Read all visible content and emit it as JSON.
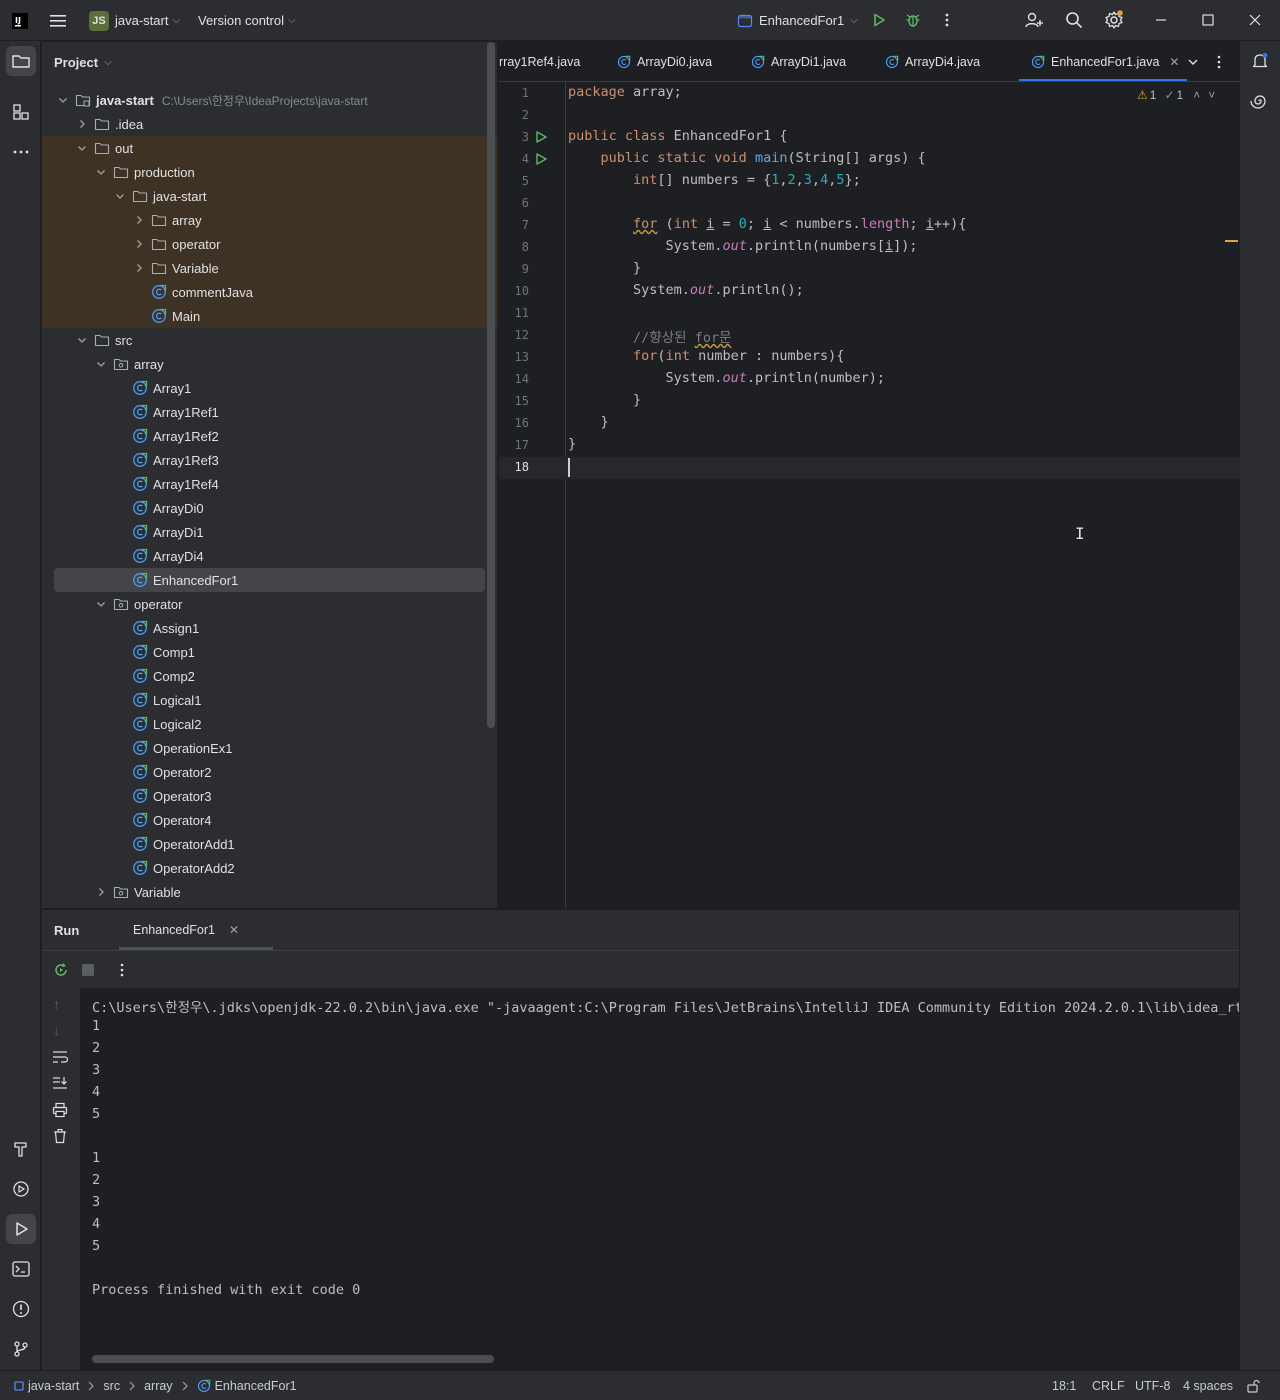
{
  "titlebar": {
    "project_badge": "JS",
    "project_name": "java-start",
    "vcs_label": "Version control",
    "run_config": "EnhancedFor1"
  },
  "project_panel": {
    "title": "Project",
    "tree": [
      {
        "label": "java-start",
        "path": "C:\\Users\\한정우\\IdeaProjects\\java-start",
        "indent": 0,
        "chevron": "down",
        "icon": "module",
        "bg": "none",
        "bold": true
      },
      {
        "label": ".idea",
        "indent": 1,
        "chevron": "right",
        "icon": "folder",
        "bg": "none"
      },
      {
        "label": "out",
        "indent": 1,
        "chevron": "down",
        "icon": "folder",
        "bg": "out"
      },
      {
        "label": "production",
        "indent": 2,
        "chevron": "down",
        "icon": "folder",
        "bg": "out"
      },
      {
        "label": "java-start",
        "indent": 3,
        "chevron": "down",
        "icon": "folder",
        "bg": "out"
      },
      {
        "label": "array",
        "indent": 4,
        "chevron": "right",
        "icon": "folder",
        "bg": "out"
      },
      {
        "label": "operator",
        "indent": 4,
        "chevron": "right",
        "icon": "folder",
        "bg": "out"
      },
      {
        "label": "Variable",
        "indent": 4,
        "chevron": "right",
        "icon": "folder",
        "bg": "out"
      },
      {
        "label": "commentJava",
        "indent": 4,
        "chevron": "none",
        "icon": "class",
        "bg": "out"
      },
      {
        "label": "Main",
        "indent": 4,
        "chevron": "none",
        "icon": "class",
        "bg": "out"
      },
      {
        "label": "src",
        "indent": 1,
        "chevron": "down",
        "icon": "folder",
        "bg": "none"
      },
      {
        "label": "array",
        "indent": 2,
        "chevron": "down",
        "icon": "package",
        "bg": "none"
      },
      {
        "label": "Array1",
        "indent": 3,
        "chevron": "none",
        "icon": "class",
        "bg": "none"
      },
      {
        "label": "Array1Ref1",
        "indent": 3,
        "chevron": "none",
        "icon": "class",
        "bg": "none"
      },
      {
        "label": "Array1Ref2",
        "indent": 3,
        "chevron": "none",
        "icon": "class",
        "bg": "none"
      },
      {
        "label": "Array1Ref3",
        "indent": 3,
        "chevron": "none",
        "icon": "class",
        "bg": "none"
      },
      {
        "label": "Array1Ref4",
        "indent": 3,
        "chevron": "none",
        "icon": "class",
        "bg": "none"
      },
      {
        "label": "ArrayDi0",
        "indent": 3,
        "chevron": "none",
        "icon": "class",
        "bg": "none"
      },
      {
        "label": "ArrayDi1",
        "indent": 3,
        "chevron": "none",
        "icon": "class",
        "bg": "none"
      },
      {
        "label": "ArrayDi4",
        "indent": 3,
        "chevron": "none",
        "icon": "class",
        "bg": "none"
      },
      {
        "label": "EnhancedFor1",
        "indent": 3,
        "chevron": "none",
        "icon": "class",
        "bg": "selected"
      },
      {
        "label": "operator",
        "indent": 2,
        "chevron": "down",
        "icon": "package",
        "bg": "none"
      },
      {
        "label": "Assign1",
        "indent": 3,
        "chevron": "none",
        "icon": "class",
        "bg": "none"
      },
      {
        "label": "Comp1",
        "indent": 3,
        "chevron": "none",
        "icon": "class",
        "bg": "none"
      },
      {
        "label": "Comp2",
        "indent": 3,
        "chevron": "none",
        "icon": "class",
        "bg": "none"
      },
      {
        "label": "Logical1",
        "indent": 3,
        "chevron": "none",
        "icon": "class",
        "bg": "none"
      },
      {
        "label": "Logical2",
        "indent": 3,
        "chevron": "none",
        "icon": "class",
        "bg": "none"
      },
      {
        "label": "OperationEx1",
        "indent": 3,
        "chevron": "none",
        "icon": "class",
        "bg": "none"
      },
      {
        "label": "Operator2",
        "indent": 3,
        "chevron": "none",
        "icon": "class",
        "bg": "none"
      },
      {
        "label": "Operator3",
        "indent": 3,
        "chevron": "none",
        "icon": "class",
        "bg": "none"
      },
      {
        "label": "Operator4",
        "indent": 3,
        "chevron": "none",
        "icon": "class",
        "bg": "none"
      },
      {
        "label": "OperatorAdd1",
        "indent": 3,
        "chevron": "none",
        "icon": "class",
        "bg": "none"
      },
      {
        "label": "OperatorAdd2",
        "indent": 3,
        "chevron": "none",
        "icon": "class",
        "bg": "none"
      },
      {
        "label": "Variable",
        "indent": 2,
        "chevron": "right",
        "icon": "package",
        "bg": "none"
      }
    ]
  },
  "editor": {
    "tabs": [
      {
        "label": "rray1Ref4.java",
        "active": false
      },
      {
        "label": "ArrayDi0.java",
        "active": false
      },
      {
        "label": "ArrayDi1.java",
        "active": false
      },
      {
        "label": "ArrayDi4.java",
        "active": false
      },
      {
        "label": "EnhancedFor1.java",
        "active": true
      }
    ],
    "warnings_count": "1",
    "checks_count": "1",
    "current_line": 18,
    "run_gutter_lines": [
      3,
      4
    ],
    "lines": [
      [
        [
          "kw",
          "package"
        ],
        [
          "",
          " array;"
        ]
      ],
      [],
      [
        [
          "kw",
          "public class "
        ],
        [
          "",
          "EnhancedFor1 {"
        ]
      ],
      [
        [
          "",
          "    "
        ],
        [
          "kw",
          "public static void "
        ],
        [
          "fn",
          "main"
        ],
        [
          "",
          "(String[] args) {"
        ]
      ],
      [
        [
          "",
          "        "
        ],
        [
          "kw",
          "int"
        ],
        [
          "",
          "[] numbers = {"
        ],
        [
          "num",
          "1"
        ],
        [
          "",
          ","
        ],
        [
          "num",
          "2"
        ],
        [
          "",
          ","
        ],
        [
          "num",
          "3"
        ],
        [
          "",
          ","
        ],
        [
          "num",
          "4"
        ],
        [
          "",
          ","
        ],
        [
          "num",
          "5"
        ],
        [
          "",
          "};"
        ]
      ],
      [],
      [
        [
          "",
          "        "
        ],
        [
          "kw warn-u",
          "for"
        ],
        [
          "",
          " ("
        ],
        [
          "kw",
          "int "
        ],
        [
          "param",
          "i"
        ],
        [
          "",
          " = "
        ],
        [
          "num",
          "0"
        ],
        [
          "",
          "; "
        ],
        [
          "param",
          "i"
        ],
        [
          "",
          " < numbers."
        ],
        [
          "fld",
          "length"
        ],
        [
          "",
          "; "
        ],
        [
          "param",
          "i"
        ],
        [
          "",
          "++){"
        ]
      ],
      [
        [
          "",
          "            System."
        ],
        [
          "stat",
          "out"
        ],
        [
          "",
          ".println(numbers["
        ],
        [
          "param",
          "i"
        ],
        [
          "",
          "]);"
        ]
      ],
      [
        [
          "",
          "        }"
        ]
      ],
      [
        [
          "",
          "        System."
        ],
        [
          "stat",
          "out"
        ],
        [
          "",
          ".println();"
        ]
      ],
      [],
      [
        [
          "",
          "        "
        ],
        [
          "cmt",
          "//향상된 "
        ],
        [
          "cmt warn-u",
          "for문"
        ]
      ],
      [
        [
          "",
          "        "
        ],
        [
          "kw",
          "for"
        ],
        [
          "",
          "("
        ],
        [
          "kw",
          "int "
        ],
        [
          "",
          "number : numbers){"
        ]
      ],
      [
        [
          "",
          "            System."
        ],
        [
          "stat",
          "out"
        ],
        [
          "",
          ".println(number);"
        ]
      ],
      [
        [
          "",
          "        }"
        ]
      ],
      [
        [
          "",
          "    }"
        ]
      ],
      [
        [
          "",
          "}"
        ]
      ],
      []
    ]
  },
  "run_panel": {
    "title": "Run",
    "tab_label": "EnhancedFor1",
    "console_lines": [
      "C:\\Users\\한정우\\.jdks\\openjdk-22.0.2\\bin\\java.exe \"-javaagent:C:\\Program Files\\JetBrains\\IntelliJ IDEA Community Edition 2024.2.0.1\\lib\\idea_rt.j",
      "1",
      "2",
      "3",
      "4",
      "5",
      "",
      "1",
      "2",
      "3",
      "4",
      "5",
      "",
      "Process finished with exit code 0"
    ]
  },
  "statusbar": {
    "breadcrumb": [
      "java-start",
      "src",
      "array",
      "EnhancedFor1"
    ],
    "position": "18:1",
    "line_ending": "CRLF",
    "encoding": "UTF-8",
    "indent": "4 spaces"
  },
  "colors": {
    "accent": "#3574f0",
    "run_green": "#5fb865",
    "class_icon": "#4a9eff",
    "warning": "#e0a43a",
    "out_folder_bg": "#3d3223"
  }
}
